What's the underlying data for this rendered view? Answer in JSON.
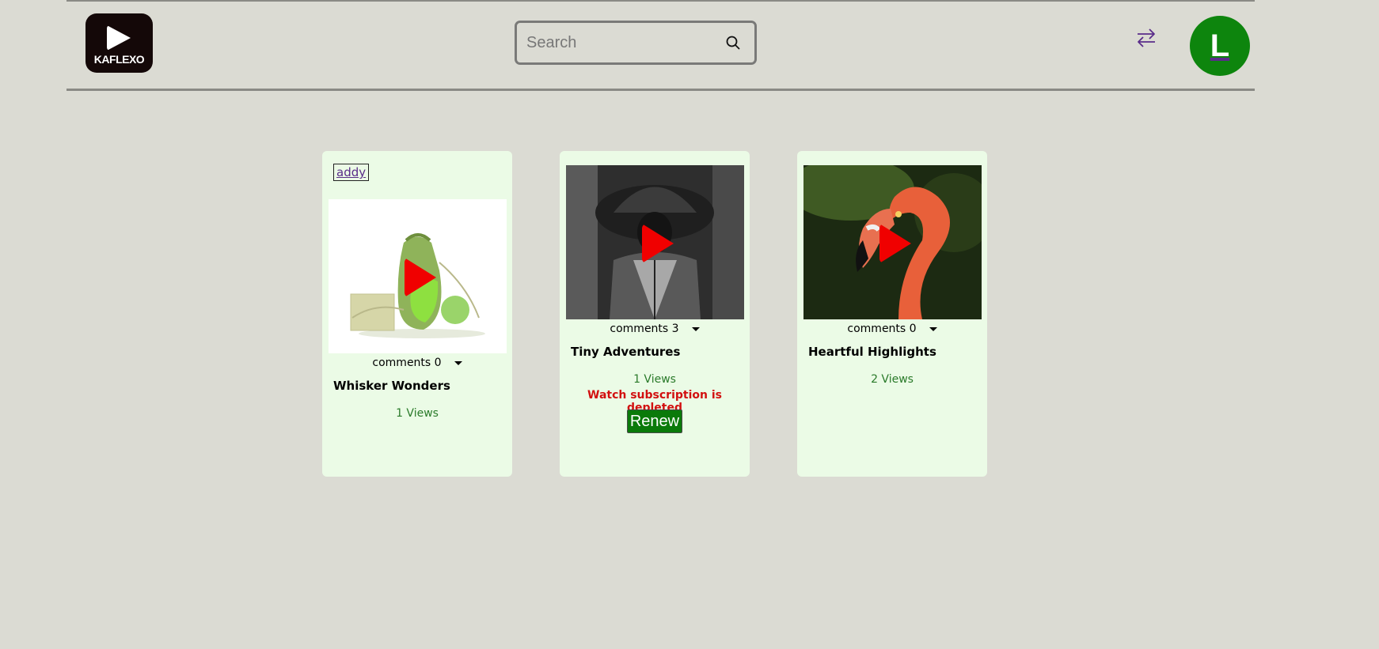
{
  "header": {
    "logo_text": "KAFLEXO",
    "search_placeholder": "Search",
    "avatar_initial": "L",
    "icons": [
      "search-icon",
      "swap-arrows-icon"
    ],
    "accent_color": "#0d850d"
  },
  "cards": [
    {
      "owner": "addy",
      "comments_label": "comments 0",
      "title": "Whisker Wonders",
      "views": "1 Views"
    },
    {
      "comments_label": "comments 3",
      "title": "Tiny Adventures",
      "views": "1 Views",
      "warning": "Watch subscription is depleted",
      "renew_label": "Renew"
    },
    {
      "comments_label": "comments 0",
      "title": "Heartful Highlights",
      "views": "2 Views"
    }
  ]
}
